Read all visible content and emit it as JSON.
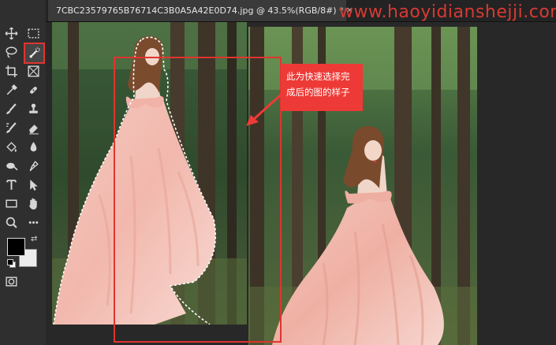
{
  "document_tab": {
    "title": "7CBC23579765B76714C3B0A5A42E0D74.jpg @ 43.5%(RGB/8#) *",
    "close_symbol": "×"
  },
  "watermark": "www.haoyidianshejji.com",
  "callout": {
    "text": "此为快速选择完成后的图的样子"
  },
  "tools": [
    {
      "name": "move-tool",
      "icon": "move-icon"
    },
    {
      "name": "marquee-tool",
      "icon": "rect-marquee-icon"
    },
    {
      "name": "lasso-tool",
      "icon": "lasso-icon"
    },
    {
      "name": "quick-selection-tool",
      "icon": "quick-selection-brush-icon"
    },
    {
      "name": "crop-tool",
      "icon": "crop-icon"
    },
    {
      "name": "frame-tool",
      "icon": "frame-icon"
    },
    {
      "name": "eyedropper-tool",
      "icon": "eyedropper-icon"
    },
    {
      "name": "healing-tool",
      "icon": "healing-brush-icon"
    },
    {
      "name": "brush-tool",
      "icon": "brush-icon"
    },
    {
      "name": "clone-stamp-tool",
      "icon": "stamp-icon"
    },
    {
      "name": "history-brush-tool",
      "icon": "history-brush-icon"
    },
    {
      "name": "eraser-tool",
      "icon": "eraser-icon"
    },
    {
      "name": "paint-bucket-tool",
      "icon": "paint-bucket-icon"
    },
    {
      "name": "blur-tool",
      "icon": "water-drop-icon"
    },
    {
      "name": "dodge-tool",
      "icon": "dodge-icon"
    },
    {
      "name": "pen-tool",
      "icon": "pen-icon"
    },
    {
      "name": "type-tool",
      "icon": "type-icon"
    },
    {
      "name": "path-selection-tool",
      "icon": "arrow-cursor-icon"
    },
    {
      "name": "shape-tool",
      "icon": "rectangle-shape-icon"
    },
    {
      "name": "hand-tool",
      "icon": "hand-icon"
    },
    {
      "name": "zoom-tool",
      "icon": "zoom-icon"
    },
    {
      "name": "edit-toolbar",
      "icon": "more-icon"
    }
  ],
  "colors": {
    "foreground": "#000000",
    "background": "#ededed",
    "accent_red": "#e0342e"
  }
}
